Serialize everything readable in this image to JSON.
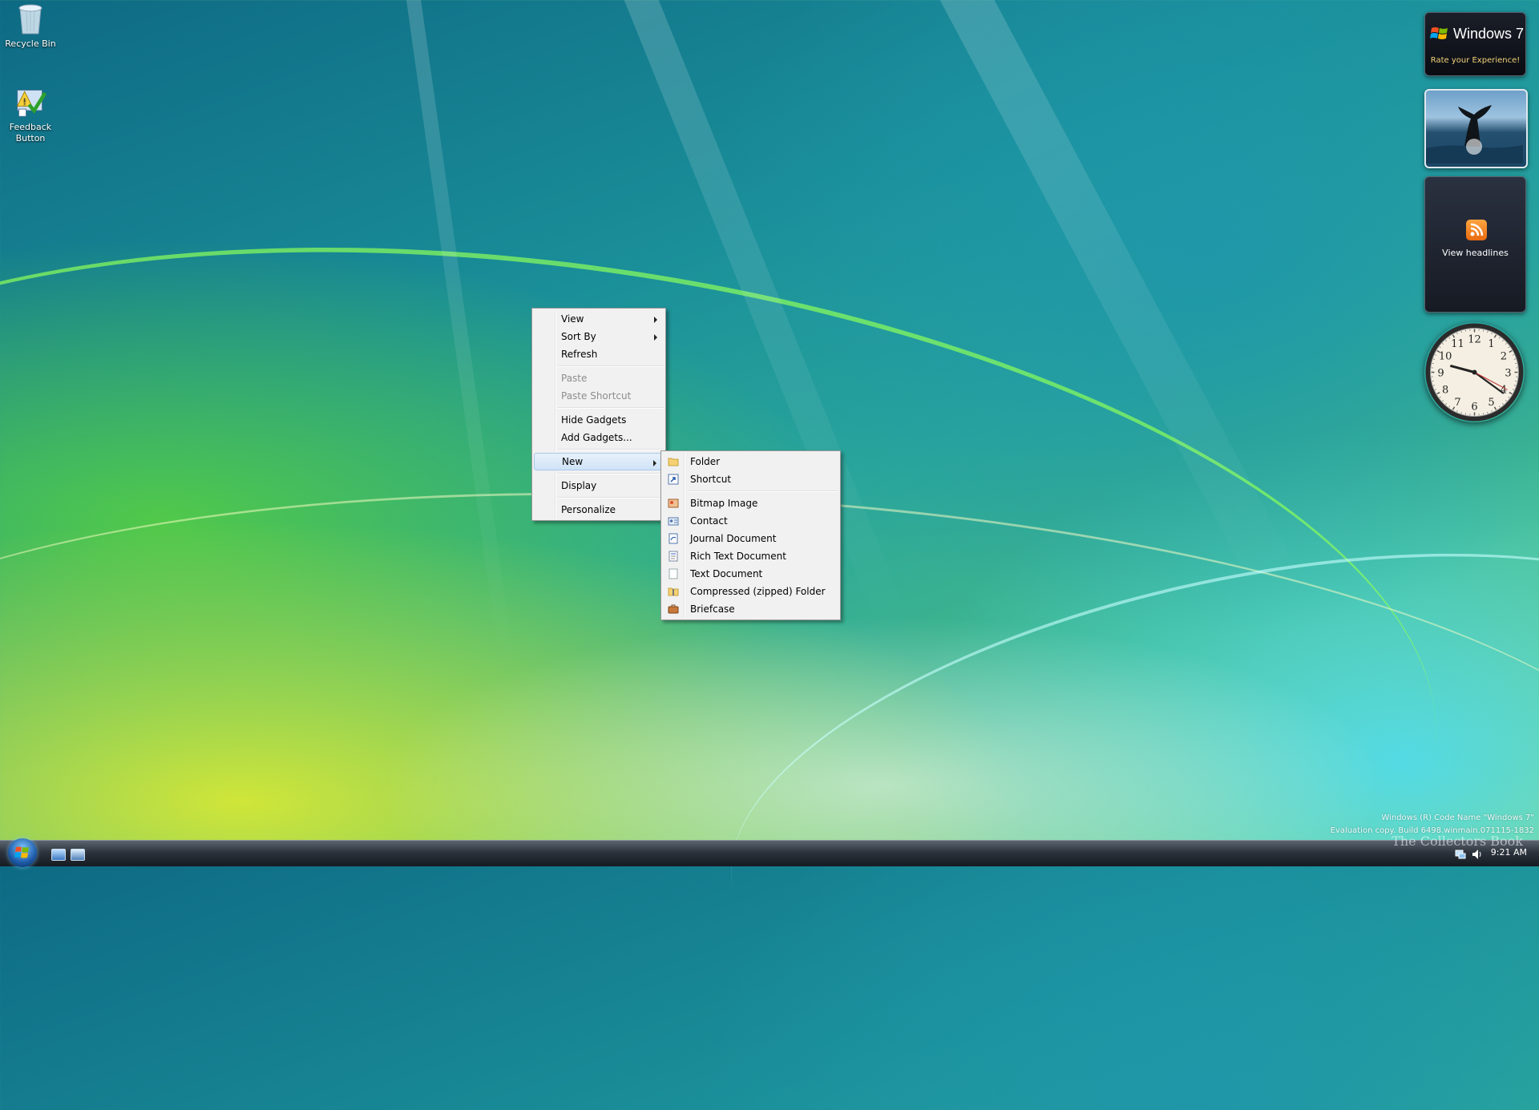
{
  "desktop": {
    "icons": [
      {
        "label": "Recycle Bin",
        "icon": "recycle-bin-icon"
      },
      {
        "label": "Feedback Button",
        "icon": "feedback-icon"
      }
    ]
  },
  "gadgets": {
    "win7": {
      "title": "Windows 7",
      "subtitle": "Rate your Experience!"
    },
    "feed": {
      "label": "View headlines"
    },
    "clock": {
      "numerals": [
        "12",
        "1",
        "2",
        "3",
        "4",
        "5",
        "6",
        "7",
        "8",
        "9",
        "10",
        "11"
      ]
    }
  },
  "context_menu": {
    "items": [
      {
        "label": "View",
        "submenu": true,
        "enabled": true
      },
      {
        "label": "Sort By",
        "submenu": true,
        "enabled": true
      },
      {
        "label": "Refresh",
        "submenu": false,
        "enabled": true
      },
      {
        "label": "Paste",
        "submenu": false,
        "enabled": false
      },
      {
        "label": "Paste Shortcut",
        "submenu": false,
        "enabled": false
      },
      {
        "label": "Hide Gadgets",
        "submenu": false,
        "enabled": true
      },
      {
        "label": "Add Gadgets...",
        "submenu": false,
        "enabled": true
      },
      {
        "label": "New",
        "submenu": true,
        "enabled": true,
        "highlighted": true
      },
      {
        "label": "Display",
        "submenu": false,
        "enabled": true
      },
      {
        "label": "Personalize",
        "submenu": false,
        "enabled": true
      }
    ]
  },
  "new_submenu": {
    "items": [
      {
        "label": "Folder",
        "icon": "folder-icon"
      },
      {
        "label": "Shortcut",
        "icon": "shortcut-icon"
      },
      {
        "label": "Bitmap Image",
        "icon": "bitmap-icon"
      },
      {
        "label": "Contact",
        "icon": "contact-icon"
      },
      {
        "label": "Journal Document",
        "icon": "journal-icon"
      },
      {
        "label": "Rich Text Document",
        "icon": "rich-text-icon"
      },
      {
        "label": "Text Document",
        "icon": "text-document-icon"
      },
      {
        "label": "Compressed (zipped) Folder",
        "icon": "zip-folder-icon"
      },
      {
        "label": "Briefcase",
        "icon": "briefcase-icon"
      }
    ]
  },
  "taskbar": {
    "clock": "9:21 AM",
    "watermark_line1": "Windows (R) Code Name \"Windows 7\"",
    "watermark_line2": "Evaluation copy. Build 6498.winmain.071115-1832",
    "brand": "The Collectors Book"
  }
}
